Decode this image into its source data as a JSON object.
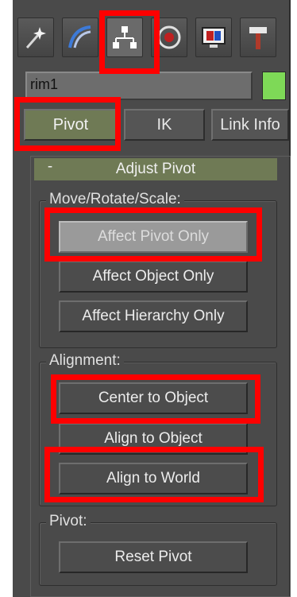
{
  "command_panel": {
    "tabs": [
      {
        "icon": "create-wand-icon"
      },
      {
        "icon": "modify-arc-icon"
      },
      {
        "icon": "hierarchy-icon",
        "active": true
      },
      {
        "icon": "motion-icon"
      },
      {
        "icon": "display-monitor-icon"
      },
      {
        "icon": "utilities-hammer-icon"
      }
    ],
    "object_name": "rim1",
    "object_color": "#7ed957"
  },
  "hierarchy_tabs": {
    "pivot": "Pivot",
    "ik": "IK",
    "link_info": "Link Info"
  },
  "adjust_pivot": {
    "collapse_mark": "-",
    "title": "Adjust Pivot",
    "move_rotate_scale": {
      "label": "Move/Rotate/Scale:",
      "affect_pivot_only": "Affect Pivot Only",
      "affect_object_only": "Affect Object Only",
      "affect_hierarchy_only": "Affect Hierarchy Only"
    },
    "alignment": {
      "label": "Alignment:",
      "center_to_object": "Center to Object",
      "align_to_object": "Align to Object",
      "align_to_world": "Align to World"
    },
    "pivot": {
      "label": "Pivot:",
      "reset_pivot": "Reset Pivot"
    }
  },
  "colors": {
    "highlight": "#ff0000",
    "active_tab": "#6f7a55",
    "panel_bg": "#4a4a4a"
  }
}
